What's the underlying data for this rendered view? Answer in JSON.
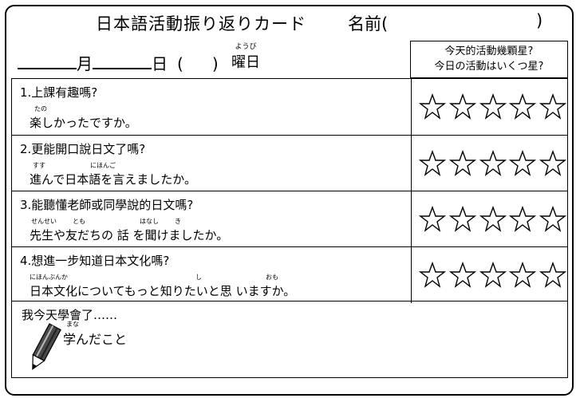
{
  "header": {
    "title": "日本語活動振り返りカード",
    "name_label": "名前(",
    "name_close": ")"
  },
  "date": {
    "month": "月",
    "day": "日",
    "paren_open": "(",
    "paren_close": ")",
    "yobi_ruby": "ようび",
    "yobi": "曜日"
  },
  "rating_header": {
    "line1": "今天的活動幾顆星?",
    "line2": "今日の活動はいくつ星?"
  },
  "questions": [
    {
      "q": "1.上課有趣嗎?",
      "ruby": [
        "たの"
      ],
      "a": "楽しかったですか。",
      "stars": 5
    },
    {
      "q": "2.更能開口說日文了嗎?",
      "ruby": [
        "すす",
        "にほんご"
      ],
      "a": "進んで日本語を言えましたか。",
      "stars": 5
    },
    {
      "q": "3.能聽懂老師或同學說的日文嗎?",
      "ruby": [
        "せんせい",
        "とも",
        "はなし",
        "き"
      ],
      "a": "先生や友だちの 話 を聞けましたか。",
      "stars": 5
    },
    {
      "q": "4.想進一步知道日本文化嗎?",
      "ruby": [
        "にほんぶんか",
        "し",
        "おも"
      ],
      "a": "日本文化についてもっと知りたいと思 いますか。",
      "stars": 5
    }
  ],
  "learned": {
    "q": "我今天學會了……",
    "ruby": "まな",
    "a": "学んだこと"
  },
  "icons": {
    "star": "star-outline-icon",
    "pencil": "pencil-icon"
  }
}
